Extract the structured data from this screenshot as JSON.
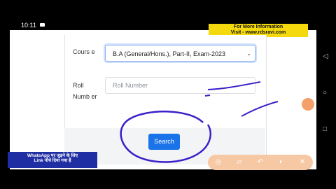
{
  "status_bar": {
    "time": "10:11"
  },
  "banner": {
    "line1": "For More Information",
    "line2": "Visit - www.rdsravi.com"
  },
  "form": {
    "course_label": "Cours e",
    "course_value": "B.A (General/Hons.), Part-II, Exam-2023",
    "roll_label": "Roll Numb er",
    "roll_placeholder": "Roll Number",
    "search_label": "Search"
  },
  "whatsapp_banner": {
    "line1": "WhatsApp पर जुड़ने के लिए",
    "line2": "Link नीचे दिया गया है"
  },
  "icons": {
    "select": "chevron-down-icon",
    "toolbar": [
      "camera-icon",
      "eraser-icon",
      "undo-icon",
      "highlighter-icon",
      "close-icon"
    ],
    "side": [
      "back-triangle-icon",
      "home-circle-icon",
      "recent-square-icon"
    ]
  },
  "colors": {
    "button": "#1a73e8",
    "banner": "#f4d90c",
    "ink": "#3b1fc8"
  }
}
